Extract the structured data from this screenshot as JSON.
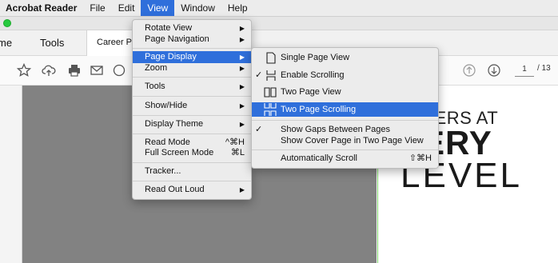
{
  "menubar": {
    "app": "Acrobat Reader",
    "items": [
      "File",
      "Edit",
      "View",
      "Window",
      "Help"
    ]
  },
  "tabs": {
    "home": "me",
    "tools": "Tools",
    "document": "Career Pl"
  },
  "toolbar": {
    "page_current": "1",
    "page_total": "/ 13"
  },
  "page_content": {
    "line1": "REERS AT",
    "line2": "VERY",
    "line3": "LEVEL"
  },
  "view_menu": {
    "rotate_view": "Rotate View",
    "page_navigation": "Page Navigation",
    "page_display": "Page Display",
    "zoom": "Zoom",
    "tools": "Tools",
    "show_hide": "Show/Hide",
    "display_theme": "Display Theme",
    "read_mode": "Read Mode",
    "read_mode_shortcut": "^⌘H",
    "full_screen_mode": "Full Screen Mode",
    "full_screen_shortcut": "⌘L",
    "tracker": "Tracker...",
    "read_out_loud": "Read Out Loud"
  },
  "page_display_submenu": {
    "single_page_view": "Single Page View",
    "enable_scrolling": "Enable Scrolling",
    "two_page_view": "Two Page View",
    "two_page_scrolling": "Two Page Scrolling",
    "show_gaps": "Show Gaps Between Pages",
    "show_cover": "Show Cover Page in Two Page View",
    "auto_scroll": "Automatically Scroll",
    "auto_scroll_shortcut": "⇧⌘H",
    "check_mark": "✓"
  },
  "colors": {
    "highlight": "#2f6fdb",
    "page_border": "#7fd66a",
    "gray_area": "#828282"
  }
}
